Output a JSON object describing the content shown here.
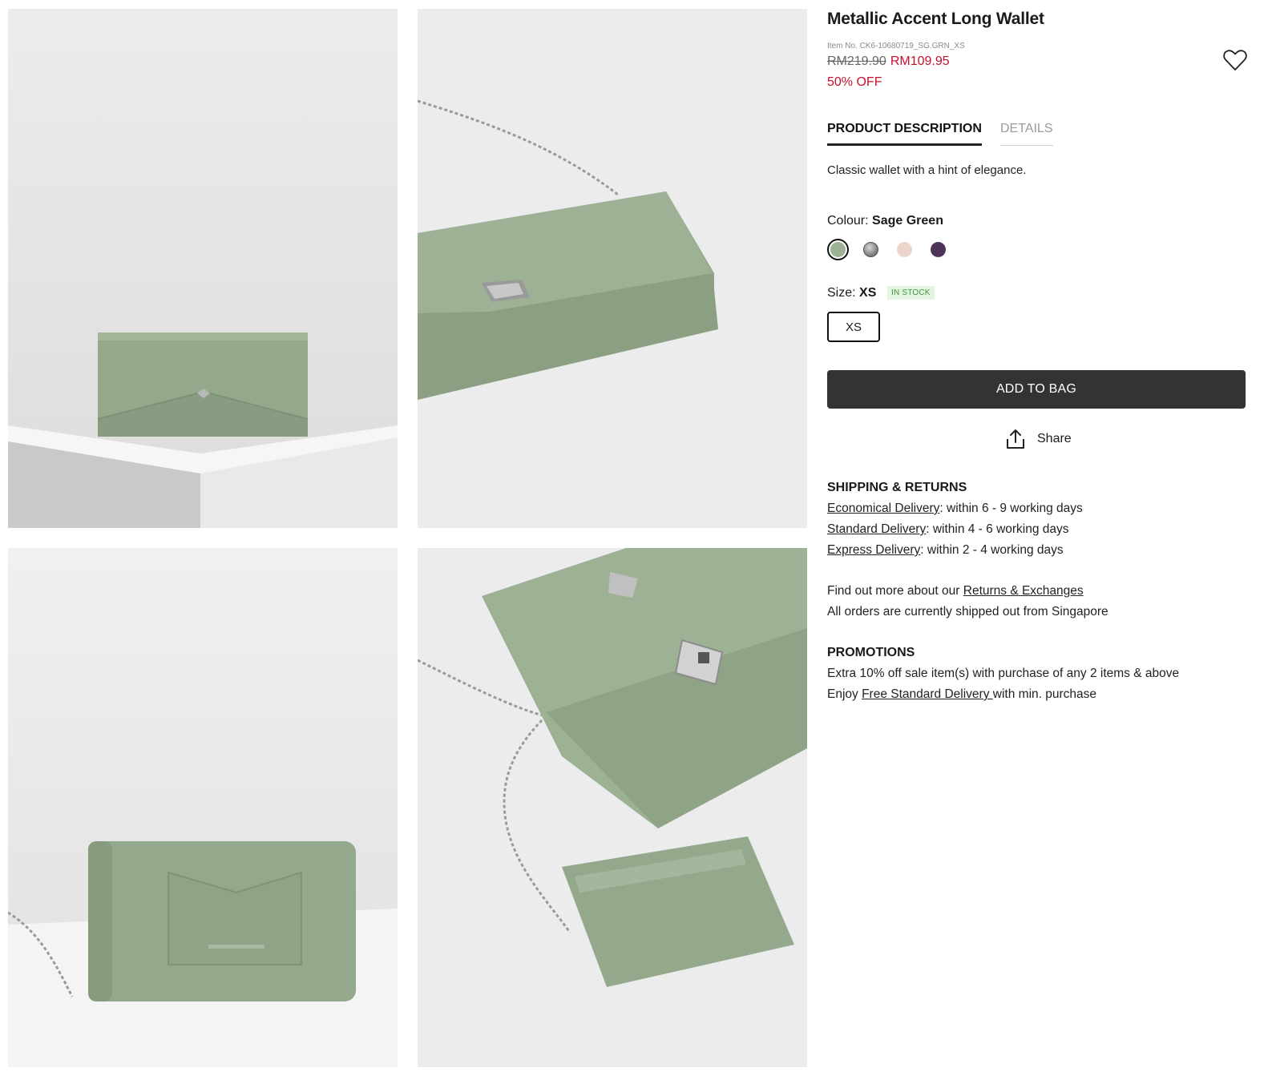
{
  "product": {
    "title": "Metallic Accent Long Wallet",
    "item_no": "Item No. CK6-10680719_SG.GRN_XS",
    "price_original": "RM219.90",
    "price_sale": "RM109.95",
    "discount": "50% OFF"
  },
  "tabs": [
    {
      "label": "PRODUCT DESCRIPTION",
      "active": true
    },
    {
      "label": "DETAILS",
      "active": false
    }
  ],
  "description": "Classic wallet with a hint of elegance.",
  "colour": {
    "label": "Colour:",
    "selected": "Sage Green",
    "swatches": [
      {
        "color": "#9db294",
        "selected": true
      },
      {
        "color": "#6e6e6e",
        "selected": false
      },
      {
        "color": "#ecd6cc",
        "selected": false
      },
      {
        "color": "#4e3557",
        "selected": false
      }
    ]
  },
  "size": {
    "label": "Size:",
    "selected": "XS",
    "stock": "IN STOCK",
    "option": "XS"
  },
  "add_to_bag": "ADD TO BAG",
  "share": "Share",
  "shipping": {
    "heading": "SHIPPING & RETURNS",
    "rows": [
      {
        "link": "Economical Delivery",
        "text": ": within 6 - 9 working days"
      },
      {
        "link": "Standard Delivery",
        "text": ": within 4 - 6 working days"
      },
      {
        "link": "Express Delivery",
        "text": ": within 2 - 4 working days"
      }
    ],
    "returns_prefix": "Find out more about our ",
    "returns_link": "Returns & Exchanges",
    "ships_from": "All orders are currently shipped out from Singapore"
  },
  "promotions": {
    "heading": "PROMOTIONS",
    "line1": "Extra 10% off sale item(s) with purchase of any 2 items & above",
    "line2_prefix": "Enjoy ",
    "line2_link": "Free Standard Delivery ",
    "line2_suffix": "with min. purchase"
  },
  "colors": {
    "accent_sale": "#c8102e",
    "button_dark": "#333333",
    "product_green": "#93a88b"
  }
}
